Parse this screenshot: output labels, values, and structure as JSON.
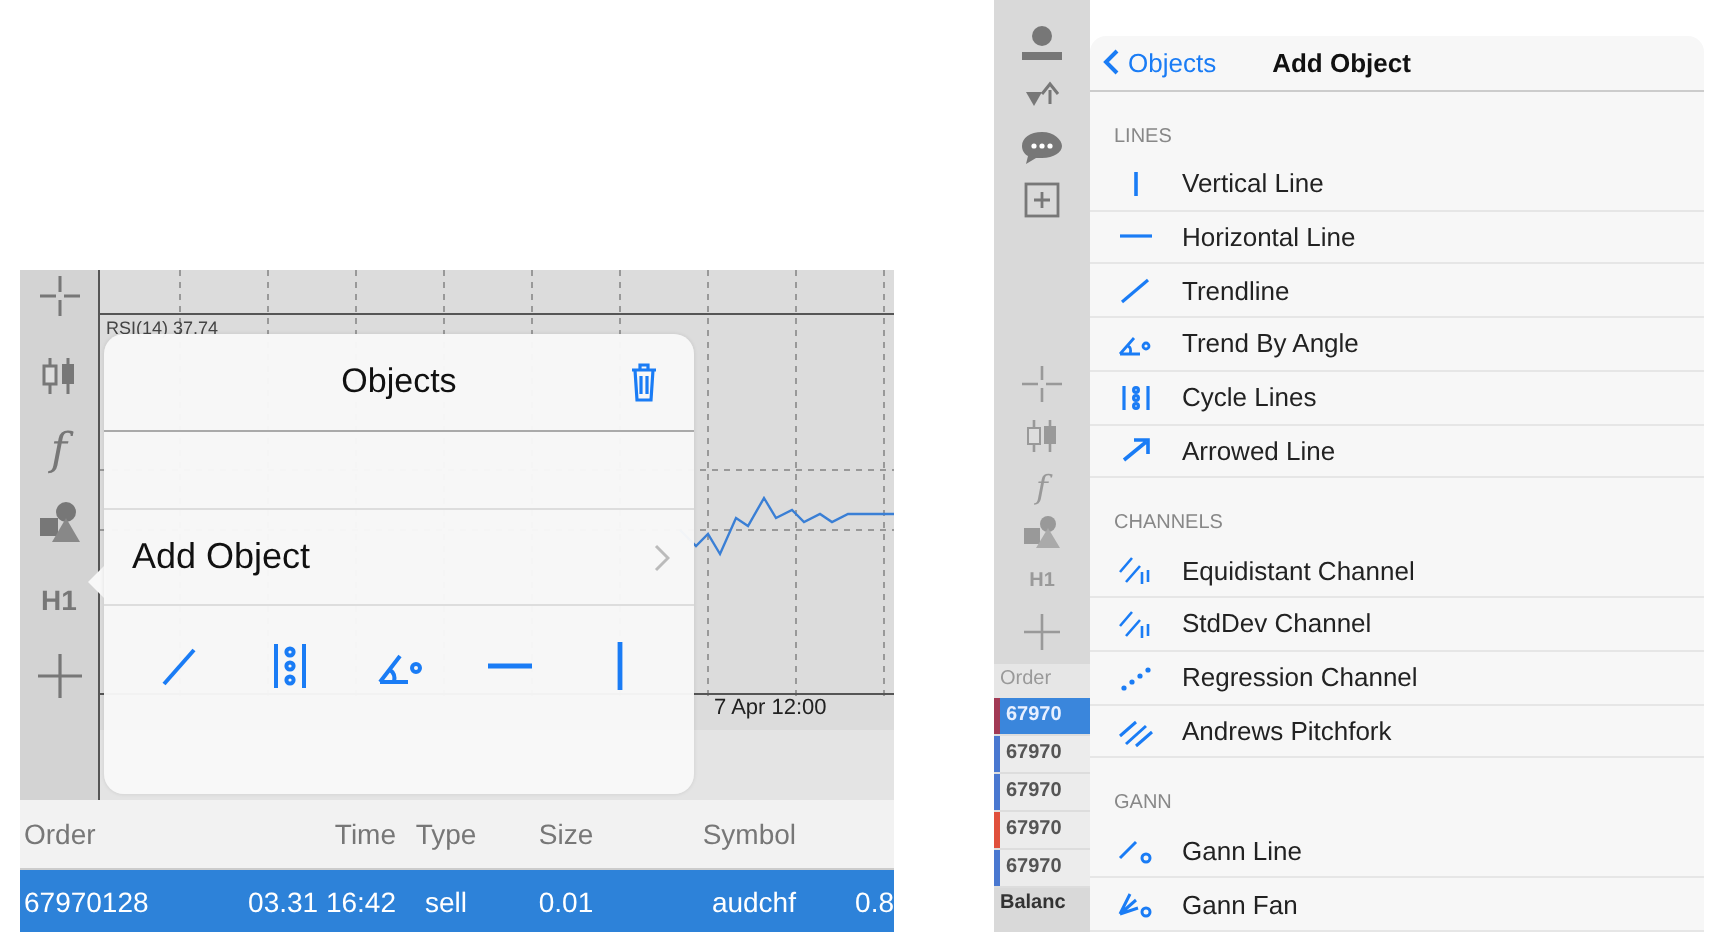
{
  "left": {
    "toolbar": {
      "function_label": "f",
      "timeframe": "H1"
    },
    "chart": {
      "indicator_label": "RSI(14) 37.74",
      "time_label": "7 Apr 12:00"
    },
    "popover": {
      "title": "Objects",
      "add_object": "Add Object",
      "quick_tools": [
        {
          "kind": "trendline"
        },
        {
          "kind": "cycle"
        },
        {
          "kind": "angle"
        },
        {
          "kind": "horizontal"
        },
        {
          "kind": "vertical"
        }
      ]
    },
    "table": {
      "columns": [
        "Order",
        "Time",
        "Type",
        "Size",
        "Symbol"
      ],
      "rows": [
        {
          "selected": true,
          "cells": [
            "67970128",
            "03.31 16:42",
            "sell",
            "0.01",
            "audchf",
            "0.8"
          ]
        }
      ]
    }
  },
  "right": {
    "toolbar": {
      "function_label": "f",
      "timeframe": "H1"
    },
    "popover": {
      "back": "Objects",
      "title": "Add Object",
      "sections": [
        {
          "header": "LINES",
          "items": [
            {
              "label": "Vertical Line",
              "kind": "vertical"
            },
            {
              "label": "Horizontal Line",
              "kind": "horizontal"
            },
            {
              "label": "Trendline",
              "kind": "trendline"
            },
            {
              "label": "Trend By Angle",
              "kind": "angle"
            },
            {
              "label": "Cycle Lines",
              "kind": "cycle"
            },
            {
              "label": "Arrowed Line",
              "kind": "arrow"
            }
          ]
        },
        {
          "header": "CHANNELS",
          "items": [
            {
              "label": "Equidistant Channel",
              "kind": "equidistant"
            },
            {
              "label": "StdDev Channel",
              "kind": "stddev"
            },
            {
              "label": "Regression Channel",
              "kind": "regression"
            },
            {
              "label": "Andrews Pitchfork",
              "kind": "pitchfork"
            }
          ]
        },
        {
          "header": "GANN",
          "items": [
            {
              "label": "Gann Line",
              "kind": "gann-line"
            },
            {
              "label": "Gann Fan",
              "kind": "gann-fan"
            }
          ]
        }
      ]
    },
    "table": {
      "header": "Order",
      "rows": [
        {
          "cell": "67970",
          "selected": true,
          "color": "#a23a55"
        },
        {
          "cell": "67970",
          "selected": false,
          "color": "#4a78d0"
        },
        {
          "cell": "67970",
          "selected": false,
          "color": "#4a78d0"
        },
        {
          "cell": "67970",
          "selected": false,
          "color": "#e0503c"
        },
        {
          "cell": "67970",
          "selected": false,
          "color": "#4a78d0"
        }
      ],
      "footer": "Balanc"
    }
  }
}
